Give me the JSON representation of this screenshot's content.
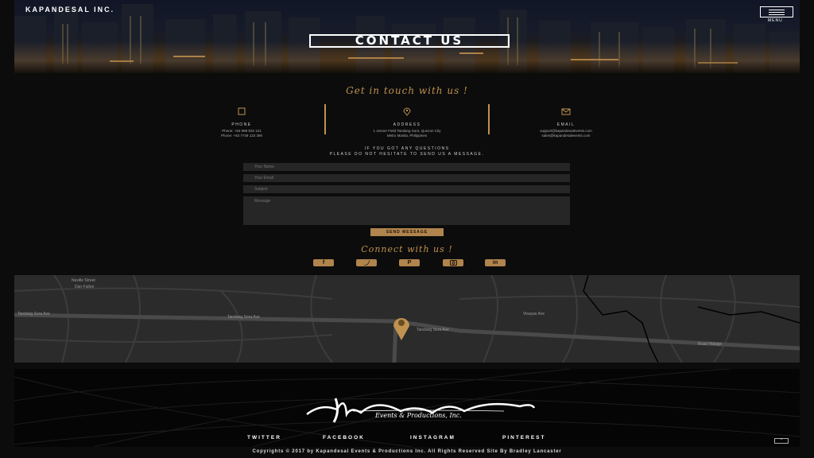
{
  "header": {
    "brand": "KAPANDESAL INC.",
    "menu_label": "MENU",
    "title": "CONTACT US"
  },
  "contact": {
    "heading": "Get in touch with us !",
    "phone": {
      "label": "PHONE",
      "line1": "Phone: +63 998 832 121",
      "line2": "Phone: +63 7749 123 390"
    },
    "address": {
      "label": "ADDRESS",
      "line1": "1 Jenner Field Tandang Sora, Quezon City",
      "line2": "Metro Manila, Philippines"
    },
    "email": {
      "label": "EMAIL",
      "line1": "support@kapandesalevents.com",
      "line2": "sales@kapandesalevents.com"
    },
    "prompt_line1": "IF YOU GOT ANY QUESTIONS",
    "prompt_line2": "PLEASE DO NOT HESITATE TO SEND US A MESSAGE."
  },
  "form": {
    "name_placeholder": "Your Name",
    "email_placeholder": "Your Email",
    "subject_placeholder": "Subject",
    "message_placeholder": "Message",
    "send_label": "SEND MESSAGE"
  },
  "connect": {
    "heading": "Connect with us !",
    "icons": [
      "facebook-icon",
      "twitter-icon",
      "pinterest-icon",
      "instagram-icon",
      "linkedin-icon"
    ]
  },
  "map": {
    "labels": [
      {
        "text": "Tandang Sora Ave",
        "id": "l1"
      },
      {
        "text": "Tandang Sora Ave",
        "id": "l2"
      },
      {
        "text": "Tandang Sora Ave",
        "id": "l3"
      },
      {
        "text": "Neville Street",
        "id": "l4"
      },
      {
        "text": "Dan Fulton",
        "id": "l5"
      },
      {
        "text": "Visayas Ave",
        "id": "l6"
      },
      {
        "text": "Road Hidalgo",
        "id": "l7"
      }
    ]
  },
  "footer": {
    "logo_text": "Kapandesal",
    "logo_subtitle": "Events & Productions, Inc.",
    "nav": [
      "TWITTER",
      "FACEBOOK",
      "INSTAGRAM",
      "PINTEREST"
    ],
    "to_top": "^",
    "copyright": "Copyrights © 2017 by Kapandesal Events & Productions Inc. All Rights Reserved Site By Bradley Lancaster"
  },
  "colors": {
    "accent": "#c0924f",
    "background": "#0c0c0c",
    "field": "#262626",
    "map": "#2b2b2b"
  }
}
